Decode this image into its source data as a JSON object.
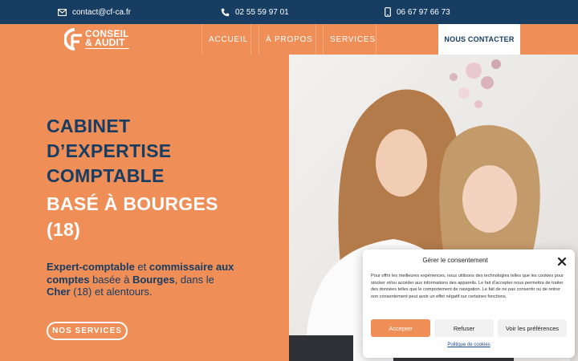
{
  "topbar": {
    "email": "contact@cf-ca.fr",
    "phone": "02 55 59 97 01",
    "mobile": "06 67 97 66 73",
    "icons": [
      "envelope-icon",
      "phone-icon",
      "mobile-icon"
    ]
  },
  "logo": {
    "line1": "CONSEIL",
    "line2": "& AUDIT"
  },
  "nav": {
    "items": [
      {
        "label": "ACCUEIL"
      },
      {
        "label": "À PROPOS"
      },
      {
        "label": "SERVICES"
      }
    ],
    "cta_label": "NOUS CONTACTER"
  },
  "hero": {
    "title_lines": [
      "CABINET",
      "D’EXPERTISE",
      "COMPTABLE"
    ],
    "subtitle_lines": [
      "BASÉ À BOURGES",
      "(18)"
    ],
    "desc": {
      "p1": "Expert-comptable",
      "p2": " et ",
      "p3": "commissaire aux comptes",
      "p4": " basée à ",
      "p5": "Bourges",
      "p6": ", dans le ",
      "p7": "Cher",
      "p8": " (18) et alentours."
    },
    "button_label": "NOS SERVICES"
  },
  "cookie": {
    "title": "Gérer le consentement",
    "text": "Pour offrir les meilleures expériences, nous utilisons des technologies telles que les cookies pour stocker et/ou accéder aux informations des appareils. Le fait d’accepter nous permettra de traiter des données telles que le comportement de navigation. Le fait de ne pas consentir ou de retirer son consentement peut avoir un effet négatif sur certaines fonctions.",
    "accept": "Accepter",
    "refuse": "Refuser",
    "prefs": "Voir les préférences",
    "policy_link": "Politique de cookies"
  },
  "colors": {
    "brand_orange": "#ef8e57",
    "navy": "#173d63"
  }
}
